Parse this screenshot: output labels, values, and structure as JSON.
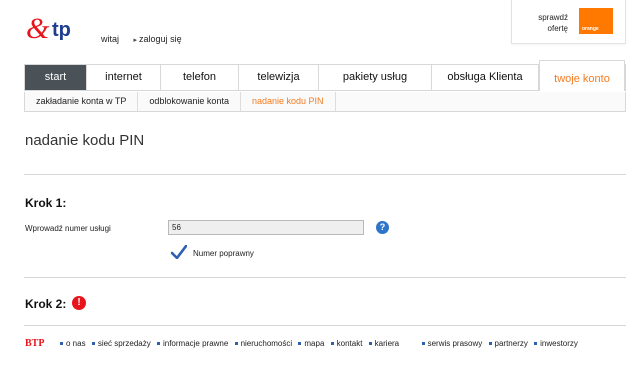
{
  "header": {
    "links": [
      {
        "label": "witaj"
      },
      {
        "label": "zaloguj się"
      }
    ],
    "promo": {
      "line1": "sprawdź",
      "line2": "ofertę",
      "brand": "orange"
    }
  },
  "nav": {
    "tabs": [
      {
        "label": "start"
      },
      {
        "label": "internet"
      },
      {
        "label": "telefon"
      },
      {
        "label": "telewizja"
      },
      {
        "label": "pakiety usług"
      },
      {
        "label": "obsługa Klienta"
      },
      {
        "label": "twoje konto"
      }
    ],
    "subtabs": [
      {
        "label": "zakładanie konta w TP"
      },
      {
        "label": "odblokowanie konta"
      },
      {
        "label": "nadanie kodu PIN"
      }
    ]
  },
  "main": {
    "title": "nadanie kodu PIN",
    "step1": {
      "title": "Krok 1:",
      "field_label": "Wprowadź numer usługi",
      "field_value": "56",
      "valid_text": "Numer poprawny"
    },
    "step2": {
      "title": "Krok 2:"
    }
  },
  "footer": {
    "links_left": [
      "o nas",
      "sieć sprzedaży",
      "informacje prawne",
      "nieruchomości",
      "mapa",
      "kontakt",
      "kariera"
    ],
    "links_right": [
      "serwis prasowy",
      "partnerzy",
      "inwestorzy"
    ]
  },
  "colors": {
    "accent": "#f47b20",
    "nav_active_bg": "#4a5257",
    "orange_brand": "#ff7900",
    "error": "#e8141b",
    "help": "#2e74c9"
  }
}
